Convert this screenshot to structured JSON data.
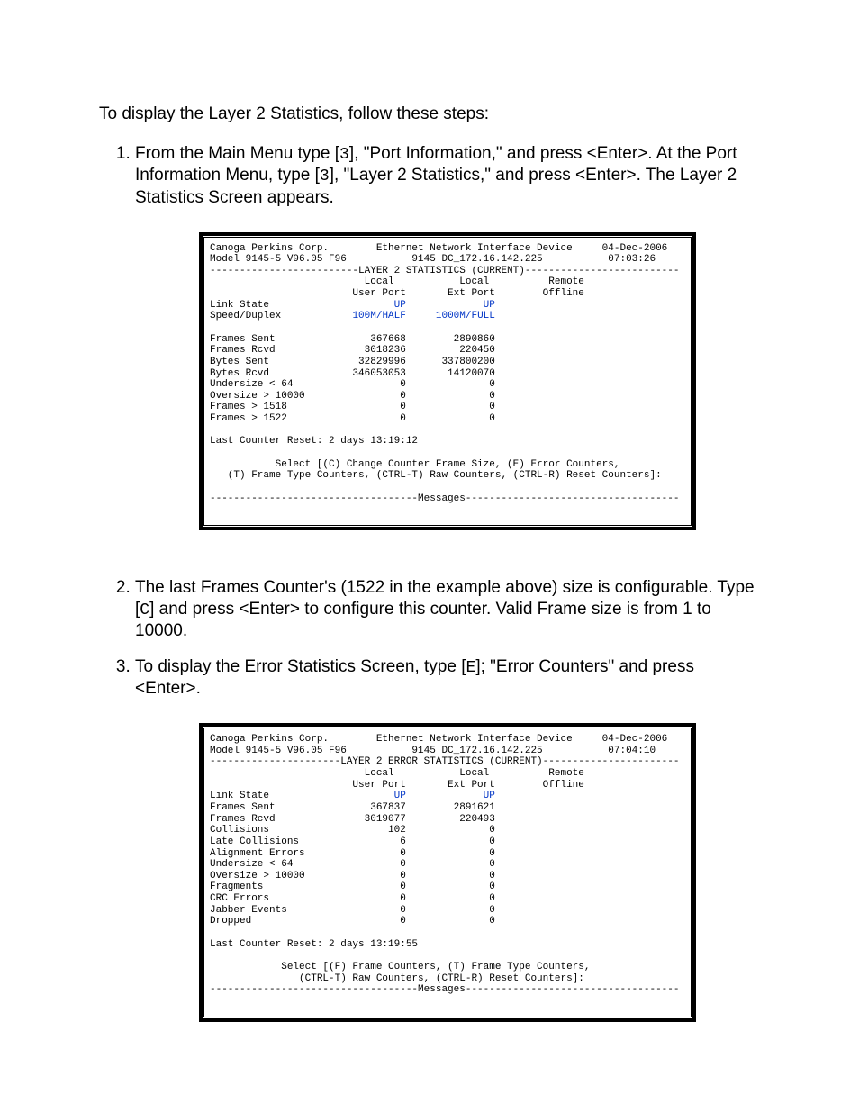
{
  "intro": "To display the Layer 2 Statistics, follow these steps:",
  "steps": {
    "s1a": "From the Main Menu type [",
    "s1key1": "3",
    "s1b": "], \"Port Information,\" and press <Enter>.  At the Port Information Menu, type [",
    "s1key2": "3",
    "s1c": "], \"Layer 2 Statistics,\" and press <Enter>.  The Layer 2 Statistics Screen appears.",
    "s2a": "The last Frames Counter's (1522 in the example above) size is configurable.  Type [",
    "s2key": "C",
    "s2b": "] and press <Enter> to configure this counter.  Valid Frame size is from 1 to 10000.",
    "s3a": "To display the Error Statistics Screen, type [",
    "s3key": "E",
    "s3b": "]; \"Error Counters\" and press <Enter>."
  },
  "term1": {
    "l01": "Canoga Perkins Corp.        Ethernet Network Interface Device     04-Dec-2006",
    "l02": "Model 9145-5 V96.05 F96           9145 DC_172.16.142.225           07:03:26",
    "l03": "-------------------------LAYER 2 STATISTICS (CURRENT)--------------------------",
    "l04": "                          Local           Local          Remote",
    "l05": "                        User Port       Ext Port        Offline",
    "l06a": "Link State                     ",
    "l06b": "UP",
    "l06c": "             ",
    "l06d": "UP",
    "l07a": "Speed/Duplex            ",
    "l07b": "100M/HALF",
    "l07c": "     ",
    "l07d": "1000M/FULL",
    "l08": "",
    "l09": "Frames Sent                367668        2890860",
    "l10": "Frames Rcvd               3018236         220450",
    "l11": "Bytes Sent               32829996      337800200",
    "l12": "Bytes Rcvd              346053053       14120070",
    "l13": "Undersize < 64                  0              0",
    "l14": "Oversize > 10000                0              0",
    "l15": "Frames > 1518                   0              0",
    "l16": "Frames > 1522                   0              0",
    "l17": "",
    "l18": "Last Counter Reset: 2 days 13:19:12",
    "l19": "",
    "l20": "           Select [(C) Change Counter Frame Size, (E) Error Counters,",
    "l21": "   (T) Frame Type Counters, (CTRL-T) Raw Counters, (CTRL-R) Reset Counters]:",
    "l22": "",
    "l23": "-----------------------------------Messages------------------------------------",
    "l24": "",
    "l25": ""
  },
  "term2": {
    "l01": "Canoga Perkins Corp.        Ethernet Network Interface Device     04-Dec-2006",
    "l02": "Model 9145-5 V96.05 F96           9145 DC_172.16.142.225           07:04:10",
    "l03": "----------------------LAYER 2 ERROR STATISTICS (CURRENT)-----------------------",
    "l04": "                          Local           Local          Remote",
    "l05": "                        User Port       Ext Port        Offline",
    "l06a": "Link State                     ",
    "l06b": "UP",
    "l06c": "             ",
    "l06d": "UP",
    "l07": "Frames Sent                367837        2891621",
    "l08": "Frames Rcvd               3019077         220493",
    "l09": "Collisions                    102              0",
    "l10": "Late Collisions                 6              0",
    "l11": "Alignment Errors                0              0",
    "l12": "Undersize < 64                  0              0",
    "l13": "Oversize > 10000                0              0",
    "l14": "Fragments                       0              0",
    "l15": "CRC Errors                      0              0",
    "l16": "Jabber Events                   0              0",
    "l17": "Dropped                         0              0",
    "l18": "",
    "l19": "Last Counter Reset: 2 days 13:19:55",
    "l20": "",
    "l21": "            Select [(F) Frame Counters, (T) Frame Type Counters,",
    "l22": "               (CTRL-T) Raw Counters, (CTRL-R) Reset Counters]:",
    "l23": "-----------------------------------Messages------------------------------------",
    "l24": "",
    "l25": ""
  }
}
